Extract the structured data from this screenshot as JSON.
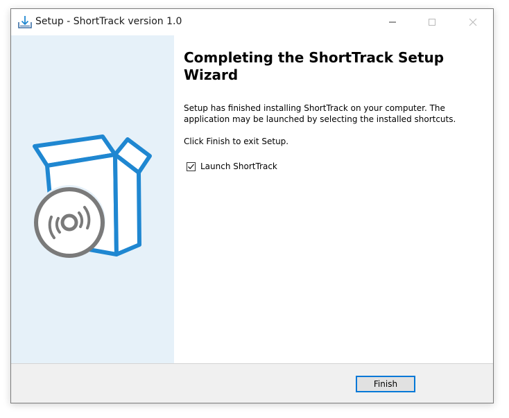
{
  "window": {
    "title": "Setup - ShortTrack version 1.0",
    "icon": "setup-download-icon",
    "controls": {
      "minimize_icon": "minimize-icon",
      "maximize_icon": "maximize-icon",
      "close_icon": "close-icon"
    }
  },
  "wizard": {
    "heading": "Completing the ShortTrack Setup Wizard",
    "paragraph1": "Setup has finished installing ShortTrack on your computer. The application may be launched by selecting the installed shortcuts.",
    "paragraph2": "Click Finish to exit Setup.",
    "launch_checkbox": {
      "label": "Launch ShortTrack",
      "checked": true
    },
    "illustration": "software-box-with-disc-icon"
  },
  "footer": {
    "finish_label": "Finish"
  },
  "colors": {
    "accent": "#0078d7",
    "left_panel_bg": "#e6f1f9",
    "footer_bg": "#f0f0f0",
    "box_blue": "#1f87d1",
    "disc_gray": "#7a7a7a"
  }
}
